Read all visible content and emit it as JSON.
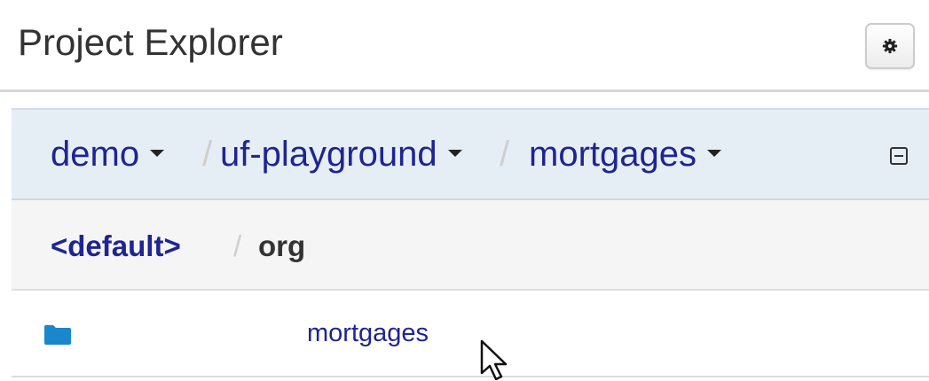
{
  "panel": {
    "title": "Project Explorer",
    "settings_icon": "gear-icon"
  },
  "repo_breadcrumb": {
    "items": [
      {
        "label": "demo"
      },
      {
        "label": "uf-playground"
      },
      {
        "label": "mortgages"
      }
    ],
    "separator": "/",
    "collapse_icon": "collapse-icon"
  },
  "path_breadcrumb": {
    "root": "<default>",
    "separator": "/",
    "current": "org"
  },
  "items": [
    {
      "icon": "folder-icon",
      "label": "mortgages"
    }
  ],
  "colors": {
    "link": "#1f2493",
    "folder": "#1a86cc",
    "repo_bar_bg": "#e6eef5",
    "path_bar_bg": "#f5f5f5"
  }
}
